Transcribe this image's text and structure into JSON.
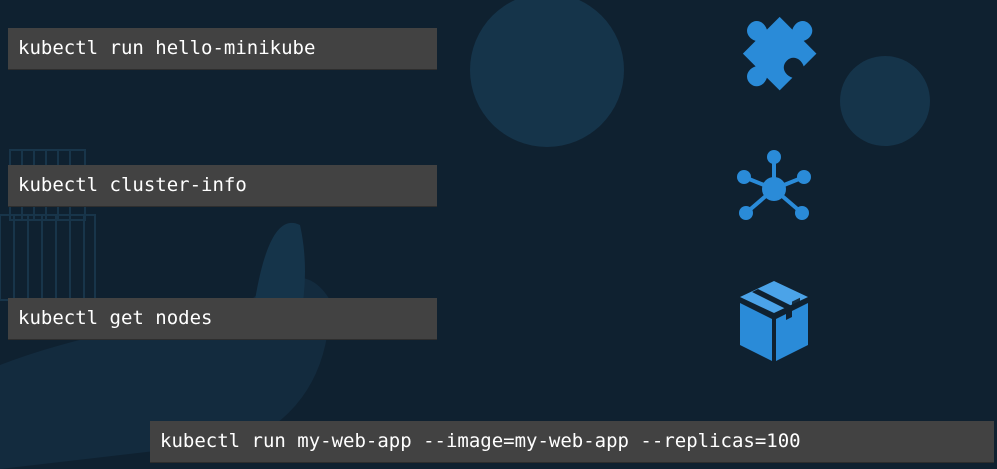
{
  "commands": {
    "run_hello": "kubectl run hello-minikube",
    "cluster_info": "kubectl cluster-info",
    "get_nodes": "kubectl get nodes",
    "run_web_app": "kubectl run my-web-app --image=my-web-app --replicas=100"
  },
  "icons": {
    "first": "puzzle-piece-icon",
    "second": "network-hub-icon",
    "third": "package-box-icon"
  },
  "colors": {
    "background": "#0f2130",
    "command_box": "#424242",
    "command_text": "#ffffff",
    "icon_blue": "#2a8bd8"
  }
}
